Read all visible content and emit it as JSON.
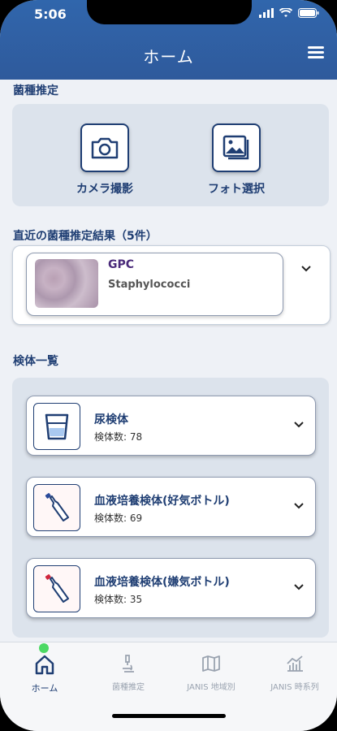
{
  "status": {
    "time": "5:06"
  },
  "header": {
    "title": "ホーム"
  },
  "identify": {
    "title": "菌種推定",
    "camera_label": "カメラ撮影",
    "photo_label": "フォト選択"
  },
  "recent": {
    "title": "直近の菌種推定結果（5件）",
    "item": {
      "code": "GPC",
      "name": "Staphylococci"
    }
  },
  "specimens": {
    "title": "検体一覧",
    "items": [
      {
        "name": "尿検体",
        "count": "検体数: 78"
      },
      {
        "name": "血液培養検体(好気ボトル)",
        "count": "検体数: 69"
      },
      {
        "name": "血液培養検体(嫌気ボトル)",
        "count": "検体数: 35"
      }
    ]
  },
  "tabs": [
    {
      "label": "ホーム",
      "icon": "home-icon",
      "active": true
    },
    {
      "label": "菌種推定",
      "icon": "microscope-icon"
    },
    {
      "label": "JANIS 地域別",
      "icon": "map-icon"
    },
    {
      "label": "JANIS 時系列",
      "icon": "chart-icon"
    }
  ],
  "colors": {
    "header": "#3066ac",
    "accent": "#1f3e73",
    "badge": "#4cd964"
  }
}
